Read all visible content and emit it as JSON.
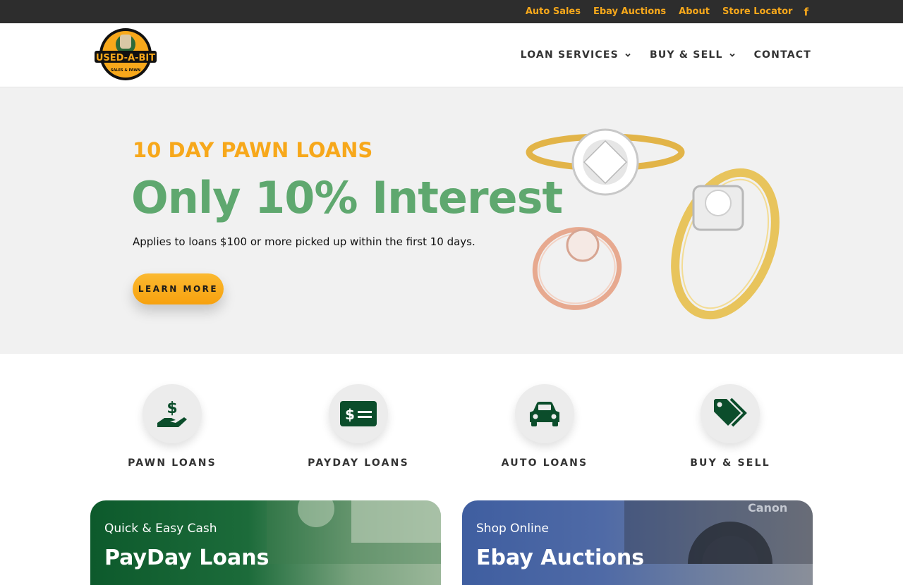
{
  "topbar": {
    "links": [
      "Auto Sales",
      "Ebay Auctions",
      "About",
      "Store Locator"
    ],
    "social_icon": "facebook-icon"
  },
  "header": {
    "logo_text": "USED-A-BIT",
    "logo_subtext": "SALES & PAWN",
    "nav": [
      {
        "label": "LOAN SERVICES",
        "has_dropdown": true
      },
      {
        "label": "BUY & SELL",
        "has_dropdown": true
      },
      {
        "label": "CONTACT",
        "has_dropdown": false
      }
    ]
  },
  "hero": {
    "kicker": "10 DAY PAWN LOANS",
    "title": "Only 10% Interest",
    "subtitle": "Applies to loans $100 or more picked up within the first 10 days.",
    "button_label": "LEARN MORE",
    "image": "rings-image"
  },
  "services": [
    {
      "label": "PAWN LOANS",
      "icon": "hand-dollar-icon"
    },
    {
      "label": "PAYDAY LOANS",
      "icon": "check-money-icon"
    },
    {
      "label": "AUTO LOANS",
      "icon": "car-icon"
    },
    {
      "label": "BUY & SELL",
      "icon": "tags-icon"
    }
  ],
  "cards": [
    {
      "kicker": "Quick & Easy Cash",
      "title": "PayDay Loans"
    },
    {
      "kicker": "Shop Online",
      "title": "Ebay Auctions"
    }
  ],
  "colors": {
    "accent": "#f7a81b",
    "green": "#5fa86f",
    "icon_green": "#0b4d2b",
    "topbar": "#2d2d2d"
  }
}
